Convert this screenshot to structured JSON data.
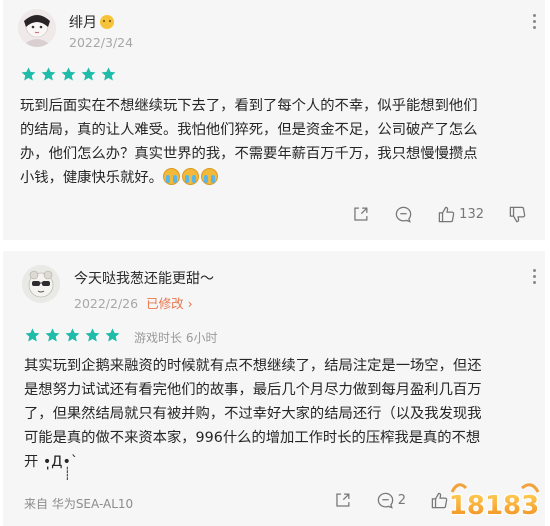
{
  "reviews": [
    {
      "username": "绯月",
      "date": "2022/3/24",
      "rating": 5,
      "text_lines": [
        "玩到后面实在不想继续玩下去了，看到了每个人的不幸，似乎能想到他们",
        "的结局，真的让人难受。我怕他们猝死，但是资金不足，公司破产了怎么",
        "办，他们怎么办？真实世界的我，不需要年薪百万千万，我只想慢慢攒点",
        "小钱，健康快乐就好。"
      ],
      "trailing_emojis": [
        "crying-face",
        "crying-face",
        "crying-face"
      ],
      "likes": "132"
    },
    {
      "username": "今天哒我葱还能更甜～",
      "date": "2022/2/26",
      "edited_label": "已修改",
      "rating": 5,
      "playtime_label": "游戏时长 6小时",
      "text_lines": [
        "其实玩到企鹅来融资的时候就有点不想继续了，结局注定是一场空，但还",
        "是想努力试试还有看完他们的故事，最后几个月尽力做到每月盈利几百万",
        "了，但果然结局就只有被并购，不过幸好大家的结局还行（以及我发现我",
        "可能是真的做不来资本家，996什么的增加工作时长的压榨我是真的不想",
        "开 •̩̩̩̩Д•̩̩̩̩`"
      ],
      "device": "来自 华为SEA-AL10",
      "comments": "2"
    }
  ],
  "colors": {
    "star": "#1fbca9",
    "edited": "#e8754c",
    "card_bg": "#f6f6f7",
    "meta_gray": "#a7a7a7"
  },
  "watermark": {
    "text": "18183"
  },
  "icons": [
    "share-icon",
    "comment-icon",
    "like-icon",
    "dislike-icon",
    "more-icon",
    "star-icon"
  ]
}
